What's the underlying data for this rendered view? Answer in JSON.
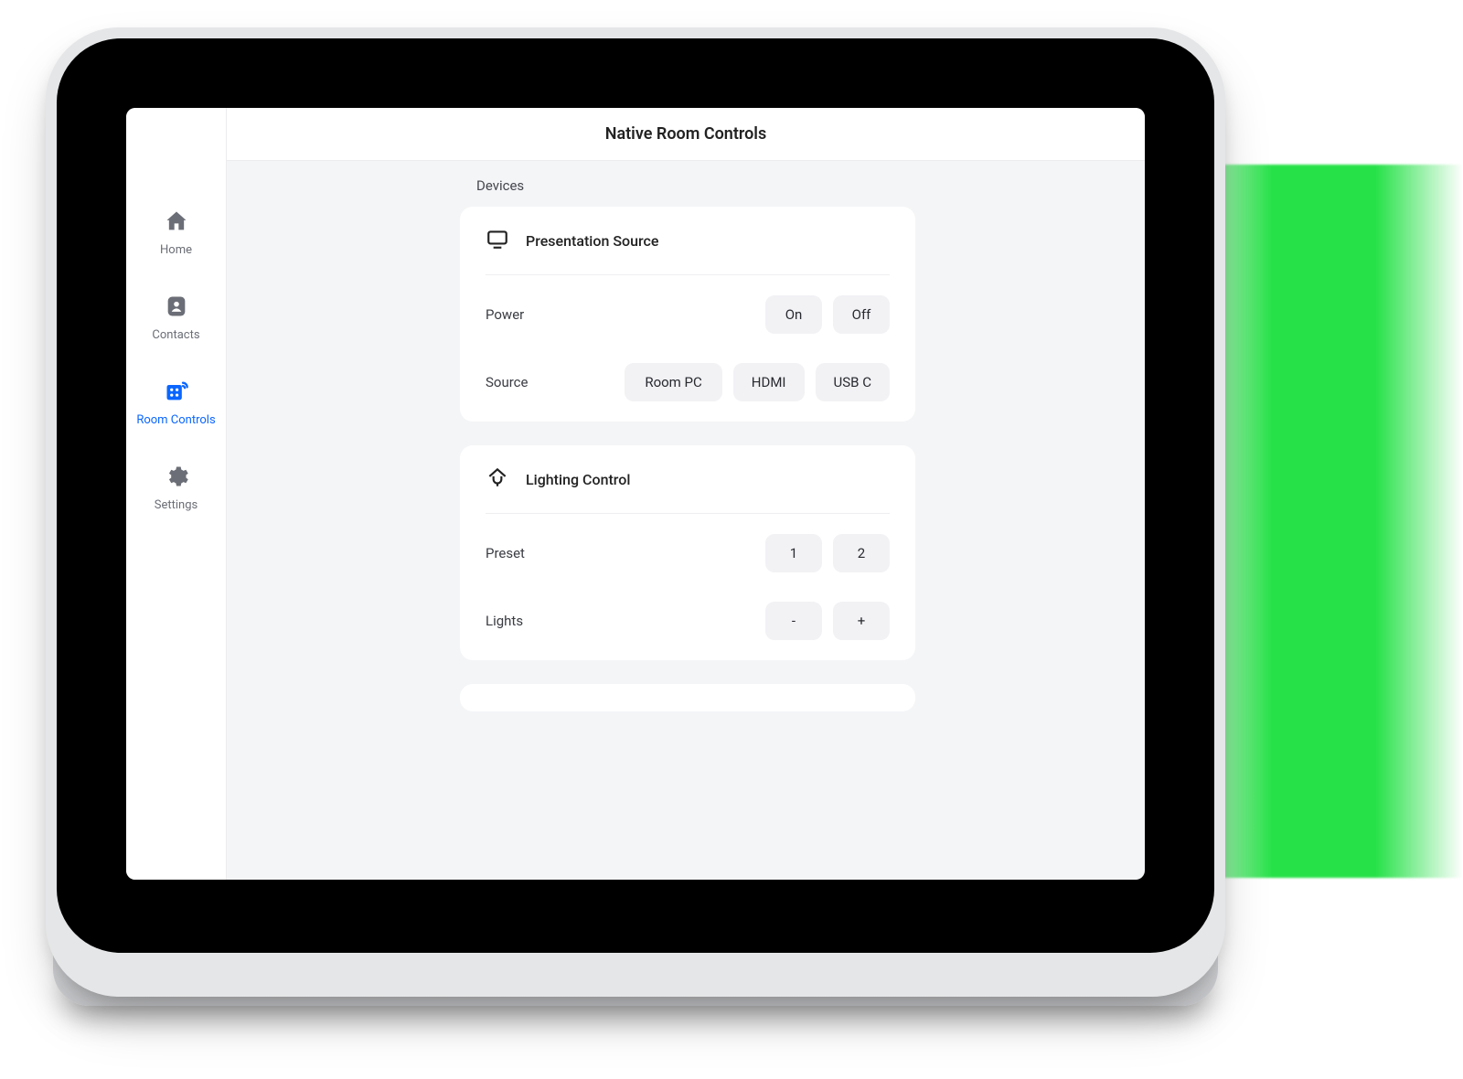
{
  "header": {
    "title": "Native Room Controls"
  },
  "sidebar": {
    "items": [
      {
        "label": "Home"
      },
      {
        "label": "Contacts"
      },
      {
        "label": "Room Controls"
      },
      {
        "label": "Settings"
      }
    ]
  },
  "section_label": "Devices",
  "cards": {
    "presentation": {
      "title": "Presentation Source",
      "power_label": "Power",
      "power_on": "On",
      "power_off": "Off",
      "source_label": "Source",
      "source_roompc": "Room PC",
      "source_hdmi": "HDMI",
      "source_usbc": "USB C"
    },
    "lighting": {
      "title": "Lighting Control",
      "preset_label": "Preset",
      "preset_1": "1",
      "preset_2": "2",
      "lights_label": "Lights",
      "lights_dec": "-",
      "lights_inc": "+"
    }
  }
}
